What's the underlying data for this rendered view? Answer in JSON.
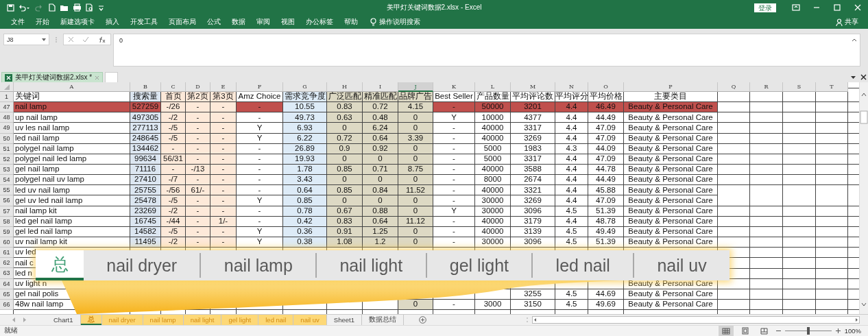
{
  "window": {
    "title": "美甲灯关键词数据2.xlsx  -  Excel",
    "sign_in": "登录"
  },
  "ribbon": {
    "tabs": [
      "文件",
      "开始",
      "新建选项卡",
      "插入",
      "开发工具",
      "页面布局",
      "公式",
      "数据",
      "审阅",
      "视图",
      "办公标签",
      "帮助"
    ],
    "tell_me": "操作说明搜索",
    "share": "共享"
  },
  "formula_bar": {
    "name_box": "J8",
    "formula": "0"
  },
  "workbook_tab": {
    "label": "美甲灯关键词数据2.xlsx *"
  },
  "columns": [
    {
      "letter": "A",
      "selected": false,
      "kind": "plain"
    },
    {
      "letter": "B",
      "selected": false,
      "kind": "plain",
      "color": "#dce6f1"
    },
    {
      "letter": "C",
      "selected": false,
      "kind": "band",
      "color": "#fde9d9"
    },
    {
      "letter": "D",
      "selected": false,
      "kind": "band",
      "color": "#fde9d9"
    },
    {
      "letter": "E",
      "selected": false,
      "kind": "band",
      "color": "#fde9d9"
    },
    {
      "letter": "F",
      "selected": false,
      "kind": "plain"
    },
    {
      "letter": "G",
      "selected": false,
      "kind": "band",
      "color": "#ddebf7"
    },
    {
      "letter": "H",
      "selected": false,
      "kind": "band",
      "color": "#ddd9c4"
    },
    {
      "letter": "I",
      "selected": false,
      "kind": "band",
      "color": "#ddd9c4"
    },
    {
      "letter": "J",
      "selected": true,
      "kind": "band",
      "color": "#ddd9c4"
    },
    {
      "letter": "K",
      "selected": false,
      "kind": "plain"
    },
    {
      "letter": "L",
      "selected": false,
      "kind": "plain"
    },
    {
      "letter": "M",
      "selected": false,
      "kind": "plain"
    },
    {
      "letter": "N",
      "selected": false,
      "kind": "plain"
    },
    {
      "letter": "O",
      "selected": false,
      "kind": "plain"
    },
    {
      "letter": "P",
      "selected": false,
      "kind": "plain"
    },
    {
      "letter": "Q",
      "selected": false,
      "kind": "plain"
    },
    {
      "letter": "R",
      "selected": false,
      "kind": "plain"
    },
    {
      "letter": "S",
      "selected": false,
      "kind": "plain"
    },
    {
      "letter": "T",
      "selected": false,
      "kind": "plain"
    }
  ],
  "header_row": {
    "number": "1",
    "cells": {
      "A": "关键词",
      "B": "搜索量",
      "C": "首页",
      "D": "第2页",
      "E": "第3页",
      "F": "Amz Choice",
      "G": "需求竞争度",
      "H": "广泛匹配",
      "I": "精准匹配",
      "J": "品牌广告",
      "K": "Best Seller",
      "L": "产品数量",
      "M": "平均评论数",
      "N": "平均评分",
      "O": "平均价格",
      "P": "主要类目"
    }
  },
  "rows": [
    {
      "number": "47",
      "highlighted": true,
      "cells": {
        "A": "nail lamp",
        "B": "527259",
        "C": "-/26",
        "D": "-",
        "E": "-",
        "F": "-",
        "G": "10.55",
        "H": "0.83",
        "I": "0.72",
        "J": "4.15",
        "K": "-",
        "L": "50000",
        "M": "3201",
        "N": "4.4",
        "O": "46.49",
        "P": "Beauty & Personal Care"
      }
    },
    {
      "number": "48",
      "highlighted": false,
      "cells": {
        "A": "up nail lamp",
        "B": "497305",
        "C": "-/2",
        "D": "-",
        "E": "-",
        "F": "-",
        "G": "49.73",
        "H": "0.63",
        "I": "0.48",
        "J": "0",
        "K": "Y",
        "L": "10000",
        "M": "4377",
        "N": "4.4",
        "O": "44.49",
        "P": "Beauty & Personal Care"
      }
    },
    {
      "number": "49",
      "highlighted": false,
      "cells": {
        "A": "uv les nail lamp",
        "B": "277113",
        "C": "-/5",
        "D": "-",
        "E": "-",
        "F": "Y",
        "G": "6.93",
        "H": "0",
        "I": "6.24",
        "J": "0",
        "K": "-",
        "L": "40000",
        "M": "3317",
        "N": "4.4",
        "O": "47.09",
        "P": "Beauty & Personal Care"
      }
    },
    {
      "number": "50",
      "highlighted": false,
      "cells": {
        "A": "led nail lamp",
        "B": "248645",
        "C": "-/5",
        "D": "-",
        "E": "-",
        "F": "Y",
        "G": "6.22",
        "H": "0.72",
        "I": "0.64",
        "J": "3.39",
        "K": "-",
        "L": "40000",
        "M": "3269",
        "N": "4.4",
        "O": "47.09",
        "P": "Beauty & Personal Care"
      }
    },
    {
      "number": "51",
      "highlighted": false,
      "cells": {
        "A": "polygel nail lamp",
        "B": "134462",
        "C": "-",
        "D": "-",
        "E": "-",
        "F": "-",
        "G": "26.89",
        "H": "0.9",
        "I": "0.92",
        "J": "0",
        "K": "-",
        "L": "5000",
        "M": "1983",
        "N": "4.3",
        "O": "44.09",
        "P": "Beauty & Personal Care"
      }
    },
    {
      "number": "52",
      "highlighted": false,
      "cells": {
        "A": "polygel nail led lamp",
        "B": "99634",
        "C": "56/31",
        "D": "-",
        "E": "-",
        "F": "-",
        "G": "19.93",
        "H": "0",
        "I": "0",
        "J": "0",
        "K": "-",
        "L": "5000",
        "M": "3317",
        "N": "4.4",
        "O": "47.09",
        "P": "Beauty & Personal Care"
      }
    },
    {
      "number": "53",
      "highlighted": false,
      "cells": {
        "A": "gel nail lamp",
        "B": "71116",
        "C": "-",
        "D": "-/13",
        "E": "-",
        "F": "-",
        "G": "1.78",
        "H": "0.85",
        "I": "0.71",
        "J": "8.75",
        "K": "-",
        "L": "40000",
        "M": "3588",
        "N": "4.4",
        "O": "44.78",
        "P": "Beauty & Personal Care"
      }
    },
    {
      "number": "54",
      "highlighted": false,
      "cells": {
        "A": "polygel nail uv lamp",
        "B": "27410",
        "C": "-/7",
        "D": "-",
        "E": "-",
        "F": "-",
        "G": "3.43",
        "H": "0",
        "I": "0",
        "J": "0",
        "K": "-",
        "L": "8000",
        "M": "2674",
        "N": "4.4",
        "O": "44.49",
        "P": "Beauty & Personal Care"
      }
    },
    {
      "number": "55",
      "highlighted": false,
      "cells": {
        "A": "led uv nail lamp",
        "B": "25755",
        "C": "-/56",
        "D": "61/-",
        "E": "-",
        "F": "-",
        "G": "0.64",
        "H": "0.85",
        "I": "0.84",
        "J": "11.52",
        "K": "-",
        "L": "40000",
        "M": "3321",
        "N": "4.4",
        "O": "45.88",
        "P": "Beauty & Personal Care"
      }
    },
    {
      "number": "56",
      "highlighted": false,
      "cells": {
        "A": "gel uv led nail lamp",
        "B": "25478",
        "C": "-/5",
        "D": "-",
        "E": "-",
        "F": "Y",
        "G": "0.85",
        "H": "0",
        "I": "0",
        "J": "0",
        "K": "-",
        "L": "30000",
        "M": "3269",
        "N": "4.4",
        "O": "47.09",
        "P": "Beauty & Personal Care"
      }
    },
    {
      "number": "57",
      "highlighted": false,
      "cells": {
        "A": "nail lamp kit",
        "B": "23269",
        "C": "-/2",
        "D": "-",
        "E": "-",
        "F": "-",
        "G": "0.78",
        "H": "0.67",
        "I": "0.88",
        "J": "0",
        "K": "Y",
        "L": "30000",
        "M": "3096",
        "N": "4.5",
        "O": "51.39",
        "P": "Beauty & Personal Care"
      }
    },
    {
      "number": "58",
      "highlighted": false,
      "cells": {
        "A": "led gel nail lamp",
        "B": "16745",
        "C": "-/44",
        "D": "-",
        "E": "1/-",
        "F": "-",
        "G": "0.42",
        "H": "0.83",
        "I": "0.64",
        "J": "11.12",
        "K": "-",
        "L": "40000",
        "M": "3179",
        "N": "4.4",
        "O": "48.78",
        "P": "Beauty & Personal Care"
      }
    },
    {
      "number": "59",
      "highlighted": false,
      "cells": {
        "A": "gel led nail lamp",
        "B": "14582",
        "C": "-/5",
        "D": "-",
        "E": "-",
        "F": "Y",
        "G": "0.36",
        "H": "0.91",
        "I": "1.25",
        "J": "0",
        "K": "-",
        "L": "40000",
        "M": "3139",
        "N": "4.5",
        "O": "49.49",
        "P": "Beauty & Personal Care"
      }
    },
    {
      "number": "60",
      "highlighted": false,
      "cells": {
        "A": "uv nail lamp kit",
        "B": "11495",
        "C": "-/2",
        "D": "-",
        "E": "-",
        "F": "Y",
        "G": "0.38",
        "H": "1.08",
        "I": "1.2",
        "J": "0",
        "K": "-",
        "L": "30000",
        "M": "3096",
        "N": "4.5",
        "O": "51.39",
        "P": "Beauty & Personal Care"
      }
    },
    {
      "number": "61",
      "highlighted": false,
      "cells": {
        "A": "uv led"
      }
    },
    {
      "number": "62",
      "highlighted": false,
      "cells": {
        "A": "nail c"
      }
    },
    {
      "number": "63",
      "highlighted": false,
      "cells": {
        "A": "led n"
      }
    },
    {
      "number": "64",
      "highlighted": false,
      "cells": {
        "A": "uv light n",
        "P": "Beauty & Personal Care"
      }
    },
    {
      "number": "65",
      "highlighted": false,
      "cells": {
        "A": "gel nail polis",
        "M": "3255",
        "N": "4.5",
        "O": "44.69",
        "P": "Beauty & Personal Care"
      }
    },
    {
      "number": "66",
      "highlighted": false,
      "cells": {
        "A": "48w nail lamp",
        "J": "0",
        "K": "-",
        "L": "3000",
        "M": "3150",
        "N": "4.5",
        "O": "49.69",
        "P": "Beauty & Personal Care"
      }
    }
  ],
  "zoomed_tabs": [
    {
      "label": "总",
      "selected": true
    },
    {
      "label": "nail dryer",
      "selected": false
    },
    {
      "label": "nail lamp",
      "selected": false
    },
    {
      "label": "nail light",
      "selected": false
    },
    {
      "label": "gel light",
      "selected": false
    },
    {
      "label": "led nail",
      "selected": false
    },
    {
      "label": "nail uv",
      "selected": false
    }
  ],
  "sheet_tabs": [
    {
      "label": "Chart1",
      "selected": false
    },
    {
      "label": "总",
      "selected": true,
      "color": "#fdd877"
    },
    {
      "label": "nail dryer",
      "selected": false,
      "color": "#fdd877"
    },
    {
      "label": "nail lamp",
      "selected": false,
      "color": "#fdd877"
    },
    {
      "label": "nail light",
      "selected": false,
      "color": "#fdd877"
    },
    {
      "label": "gel light",
      "selected": false,
      "color": "#fdd877"
    },
    {
      "label": "led nail",
      "selected": false,
      "color": "#fdd877"
    },
    {
      "label": "nail uv",
      "selected": false,
      "color": "#fdd877"
    },
    {
      "label": "Sheet1",
      "selected": false
    },
    {
      "label": "数据总结",
      "selected": false
    }
  ],
  "status_bar": {
    "status": "就绪",
    "zoom": "100%",
    "level": 0.5
  }
}
